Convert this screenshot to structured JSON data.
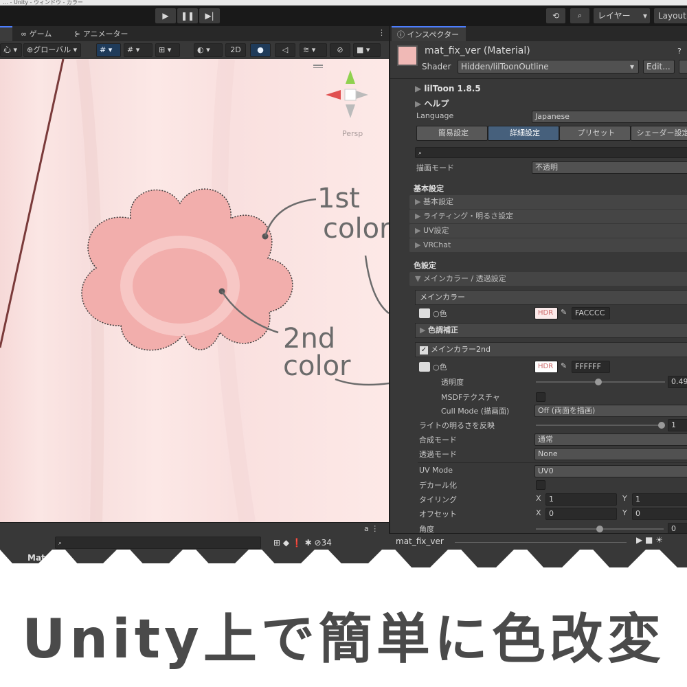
{
  "window": {
    "title": "… - Unity - ウィンドウ - カラー"
  },
  "toolbar": {
    "play_icon": "▶",
    "pause_icon": "❚❚",
    "step_icon": "▶|",
    "history_icon": "⟲",
    "search_icon": "🔍",
    "layers_label": "レイヤー",
    "layout_label": "Layout"
  },
  "scene": {
    "tabs": [
      {
        "label": "ゲーム",
        "icon": "gamepad-icon"
      },
      {
        "label": "アニメーター",
        "icon": "animator-icon"
      }
    ],
    "pivot_label": "心",
    "global_label": "グローバル",
    "mode_2d_label": "2D",
    "gizmo_label": "Persp"
  },
  "annotations": {
    "first": [
      "1st",
      "color"
    ],
    "second": [
      "2nd",
      "color"
    ]
  },
  "inspector": {
    "tab_label": "インスペクター",
    "material_name": "mat_fix_ver (Material)",
    "shader_label": "Shader",
    "shader_value": "Hidden/lilToonOutline",
    "edit_label": "Edit...",
    "liltoon_version": "lilToon 1.8.5",
    "help_label": "ヘルプ",
    "language_label": "Language",
    "language_value": "Japanese",
    "mode_tabs": [
      "簡易設定",
      "詳細設定",
      "プリセット",
      "シェーダー設定"
    ],
    "render_mode_label": "描画モード",
    "render_mode_value": "不透明",
    "basic_section": "基本設定",
    "basic_folds": [
      "基本設定",
      "ライティング・明るさ設定",
      "UV設定",
      "VRChat"
    ],
    "color_section": "色設定",
    "main_color_fold": "メインカラー / 透過設定",
    "main_color_header": "メインカラー",
    "color_label": "色",
    "hdr_label": "HDR",
    "main_color_hex": "FACCCC",
    "color_adjust_label": "色調補正",
    "main_color2_header": "メインカラー2nd",
    "color2_hex": "FFFFFF",
    "opacity_label": "透明度",
    "opacity_value": "0.49",
    "opacity_fraction": 0.49,
    "msdf_label": "MSDFテクスチャ",
    "cull_label": "Cull Mode (描画面)",
    "cull_value": "Off (両面を描画)",
    "light_label": "ライトの明るさを反映",
    "light_value": "1",
    "blend_label": "合成モード",
    "blend_value": "通常",
    "alpha_label": "透過モード",
    "alpha_value": "None",
    "uvmode_label": "UV Mode",
    "uvmode_value": "UV0",
    "decal_label": "デカール化",
    "tiling_label": "タイリング",
    "offset_label": "オフセット",
    "x_label": "X",
    "y_label": "Y",
    "tiling_x": "1",
    "tiling_y": "1",
    "offset_x": "0",
    "offset_y": "0",
    "angle_label": "角度",
    "angle_value": "0"
  },
  "bottom": {
    "materials_label": "Materials",
    "hidden_count": "34",
    "preview_name": "mat_fix_ver"
  },
  "caption": "Unity上で簡単に色改変",
  "colors": {
    "flower": "#f2aeac",
    "flower_center": "#f7c4c2",
    "annotation_line": "#6b6b6b",
    "caption": "#4a4a4a",
    "accent_blue": "#4c7eff"
  }
}
